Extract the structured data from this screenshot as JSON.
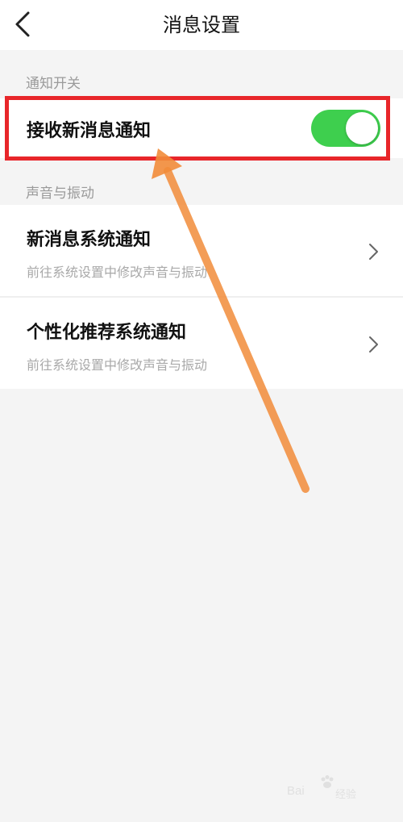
{
  "header": {
    "title": "消息设置",
    "back_icon": "chevron-left-icon"
  },
  "sections": [
    {
      "label": "通知开关",
      "items": [
        {
          "title": "接收新消息通知",
          "control": "toggle",
          "enabled": true,
          "toggle_color": "#3ecf4e"
        }
      ]
    },
    {
      "label": "声音与振动",
      "items": [
        {
          "title": "新消息系统通知",
          "subtitle": "前往系统设置中修改声音与振动",
          "control": "chevron-right-icon"
        },
        {
          "title": "个性化推荐系统通知",
          "subtitle": "前往系统设置中修改声音与振动",
          "control": "chevron-right-icon"
        }
      ]
    }
  ],
  "annotation": {
    "highlight_color": "#e8262a",
    "arrow_color": "#f28c3a"
  },
  "watermark": {
    "brand": "Bai",
    "suffix": "经验"
  }
}
